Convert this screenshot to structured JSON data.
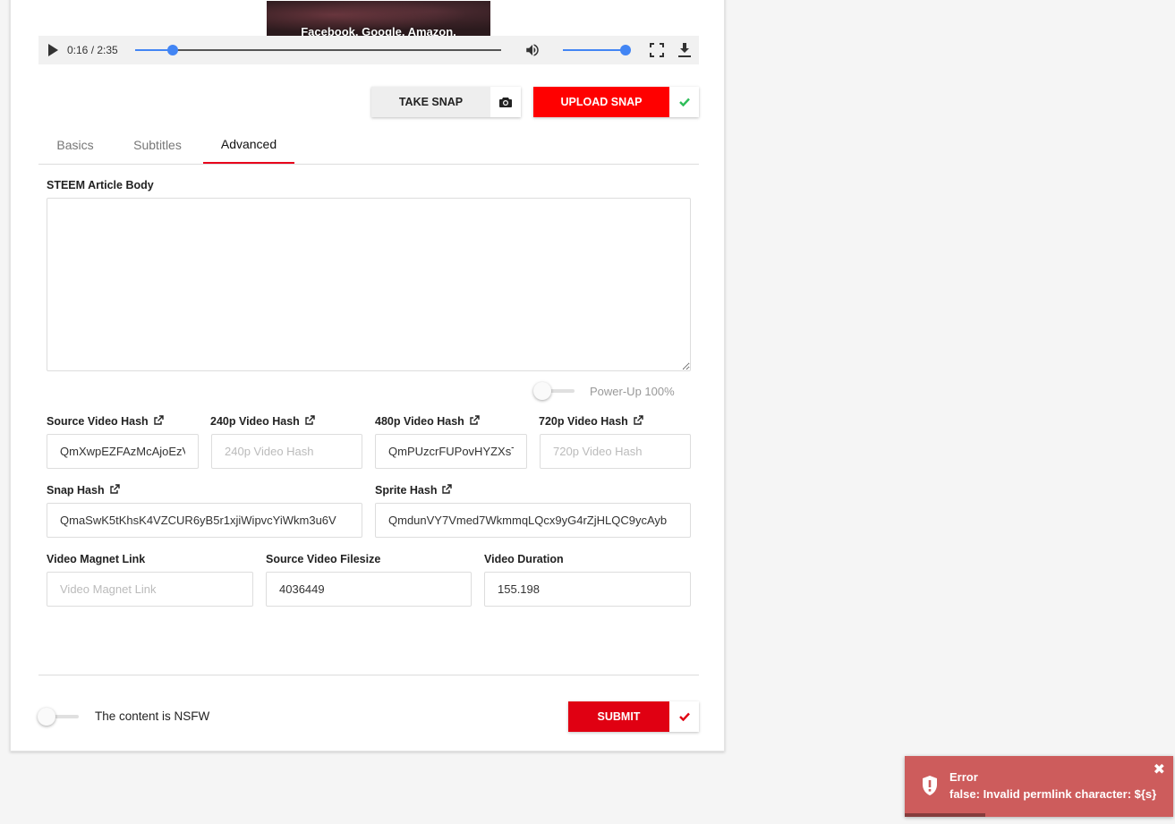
{
  "video": {
    "caption": "Facebook, Google, Amazon,",
    "time": "0:16 / 2:35",
    "progress": 0.103,
    "volume": 1.0
  },
  "snap": {
    "take_label": "TAKE SNAP",
    "upload_label": "UPLOAD SNAP"
  },
  "tabs": [
    "Basics",
    "Subtitles",
    "Advanced"
  ],
  "active_tab": "Advanced",
  "article": {
    "label": "STEEM Article Body",
    "value": ""
  },
  "powerup": {
    "label": "Power-Up 100%",
    "enabled": false
  },
  "hashes": {
    "source": {
      "label": "Source Video Hash",
      "value": "QmXwpEZFAzMcAjoEzVdWjs",
      "placeholder": "Source Video Hash"
    },
    "p240": {
      "label": "240p Video Hash",
      "value": "",
      "placeholder": "240p Video Hash"
    },
    "p480": {
      "label": "480p Video Hash",
      "value": "QmPUzcrFUPovHYZXsTkF",
      "placeholder": "480p Video Hash"
    },
    "p720": {
      "label": "720p Video Hash",
      "value": "",
      "placeholder": "720p Video Hash"
    },
    "snap": {
      "label": "Snap Hash",
      "value": "QmaSwK5tKhsK4VZCUR6yB5r1xjiWipvcYiWkm3u6V",
      "placeholder": "Snap Hash"
    },
    "sprite": {
      "label": "Sprite Hash",
      "value": "QmdunVY7Vmed7WkmmqLQcx9yG4rZjHLQC9ycAyb",
      "placeholder": "Sprite Hash"
    }
  },
  "meta": {
    "magnet": {
      "label": "Video Magnet Link",
      "value": "",
      "placeholder": "Video Magnet Link"
    },
    "filesize": {
      "label": "Source Video Filesize",
      "value": "4036449",
      "placeholder": ""
    },
    "duration": {
      "label": "Video Duration",
      "value": "155.198",
      "placeholder": ""
    }
  },
  "nsfw": {
    "label": "The content is NSFW",
    "enabled": false
  },
  "submit": {
    "label": "SUBMIT"
  },
  "toast": {
    "title": "Error",
    "message": "false: Invalid permlink character: ${s}",
    "close": "✖",
    "progress": 0.3
  },
  "colors": {
    "accent_red": "#ff0000",
    "submit_red": "#e00012",
    "player_blue": "#4285f4",
    "toast_bg": "#cd5c5c",
    "check_green": "#2ebd59",
    "check_red": "#e00012"
  }
}
